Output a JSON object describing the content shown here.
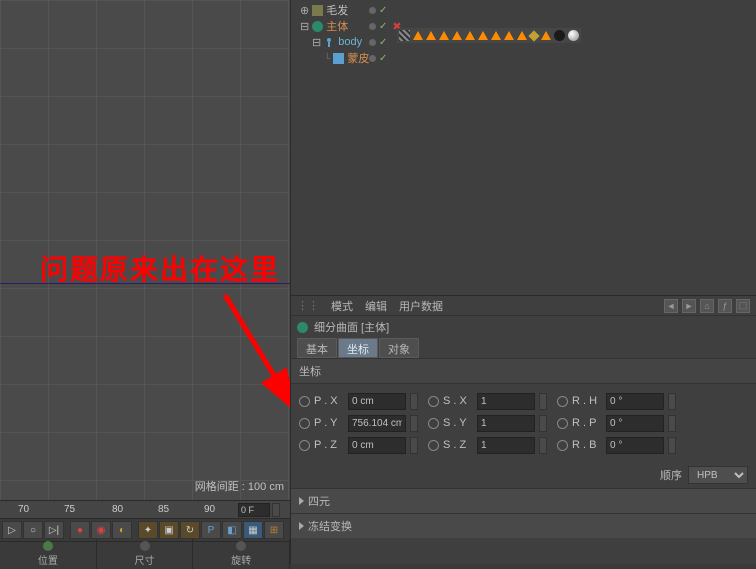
{
  "viewport": {
    "annotation": "问题原来出在这里",
    "grid_label": "网格间距 : 100 cm"
  },
  "objects": {
    "items": [
      {
        "name": "毛发",
        "color": "#c0c0c0"
      },
      {
        "name": "主体",
        "color": "#d89050"
      },
      {
        "name": "body",
        "color": "#6bb5d4"
      },
      {
        "name": "蒙皮",
        "color": "#d89050"
      }
    ]
  },
  "attr_menu": {
    "mode": "模式",
    "edit": "编辑",
    "userdata": "用户数据"
  },
  "attr_title": "细分曲面 [主体]",
  "tabs": {
    "basic": "基本",
    "coord": "坐标",
    "object": "对象"
  },
  "coord_header": "坐标",
  "coords": {
    "px_label": "P . X",
    "px": "0 cm",
    "py_label": "P . Y",
    "py": "756.104 cm",
    "pz_label": "P . Z",
    "pz": "0 cm",
    "sx_label": "S . X",
    "sx": "1",
    "sy_label": "S . Y",
    "sy": "1",
    "sz_label": "S . Z",
    "sz": "1",
    "rh_label": "R . H",
    "rh": "0 °",
    "rp_label": "R . P",
    "rp": "0 °",
    "rb_label": "R . B",
    "rb": "0 °"
  },
  "order_label": "顺序",
  "order_value": "HPB",
  "section_quat": "四元",
  "section_freeze": "冻结变换",
  "timeline": {
    "ticks": [
      "70",
      "75",
      "80",
      "85",
      "90"
    ],
    "frame": "0 F",
    "tabs": {
      "position": "位置",
      "size": "尺寸",
      "rotation": "旋转"
    }
  }
}
